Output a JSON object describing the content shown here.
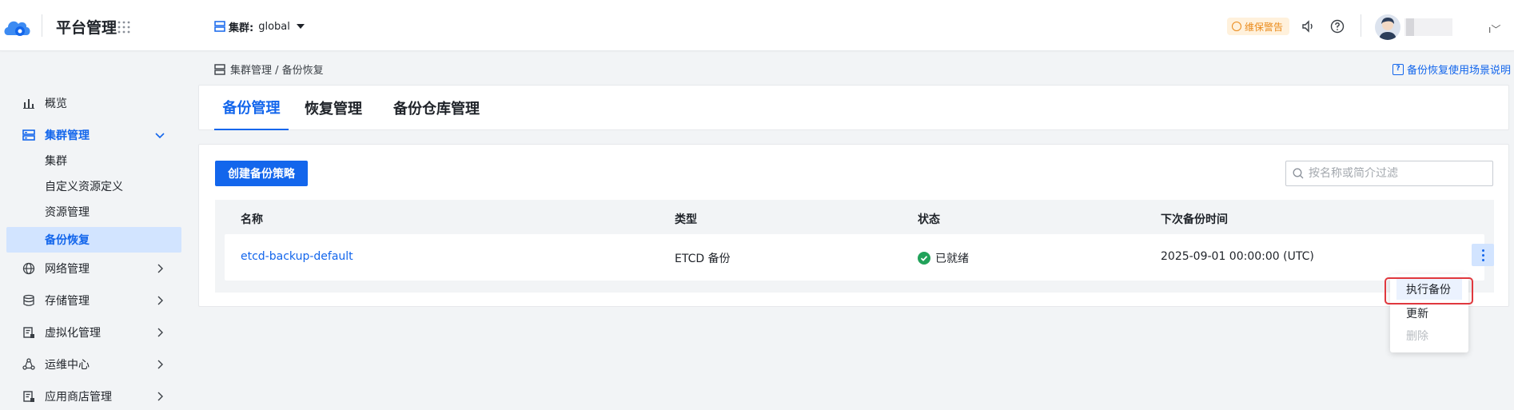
{
  "header": {
    "app_title": "平台管理",
    "cluster_label": "集群:",
    "cluster_value": "global",
    "warning_badge": "维保警告"
  },
  "sidebar": {
    "items": [
      {
        "label": "概览",
        "icon": "bar-chart-icon"
      },
      {
        "label": "集群管理",
        "icon": "cluster-icon",
        "expanded": true,
        "children": [
          "集群",
          "自定义资源定义",
          "资源管理",
          "备份恢复"
        ],
        "selected_child": "备份恢复"
      },
      {
        "label": "网络管理",
        "icon": "globe-icon"
      },
      {
        "label": "存储管理",
        "icon": "database-icon"
      },
      {
        "label": "虚拟化管理",
        "icon": "virtualization-icon"
      },
      {
        "label": "运维中心",
        "icon": "ops-icon"
      },
      {
        "label": "应用商店管理",
        "icon": "app-store-icon"
      }
    ]
  },
  "breadcrumb": {
    "path": "集群管理 / 备份恢复"
  },
  "help_link": "备份恢复使用场景说明",
  "tabs": [
    {
      "label": "备份管理",
      "active": true
    },
    {
      "label": "恢复管理",
      "active": false
    },
    {
      "label": "备份仓库管理",
      "active": false
    }
  ],
  "toolbar": {
    "create_button": "创建备份策略",
    "search_placeholder": "按名称或简介过滤"
  },
  "table": {
    "columns": [
      "名称",
      "类型",
      "状态",
      "下次备份时间"
    ],
    "rows": [
      {
        "name": "etcd-backup-default",
        "type": "ETCD 备份",
        "status": "已就绪",
        "next_backup": "2025-09-01 00:00:00 (UTC)"
      }
    ]
  },
  "row_menu": {
    "items": [
      "执行备份",
      "更新",
      "删除"
    ],
    "hovered": "执行备份",
    "disabled": [
      "删除"
    ]
  },
  "colors": {
    "primary": "#1366ec",
    "selected_bg": "#d2e4ff",
    "success": "#21a25a",
    "warning": "#ea8a1a",
    "highlight_border": "#e0383e"
  }
}
